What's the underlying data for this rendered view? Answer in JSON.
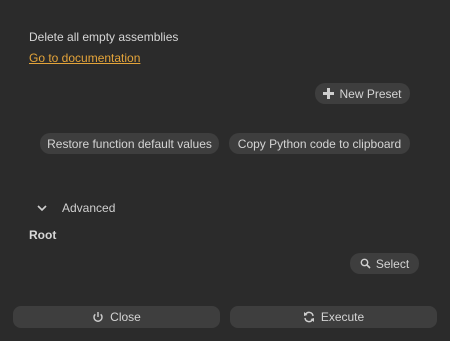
{
  "content": {
    "description": "Delete all empty assemblies",
    "doc_link": "Go to documentation"
  },
  "presets": {
    "new_preset_label": "New Preset"
  },
  "actions": {
    "restore_label": "Restore function default values",
    "copy_label": "Copy Python code to clipboard"
  },
  "advanced": {
    "label": "Advanced",
    "expanded": false
  },
  "root": {
    "label": "Root",
    "select_label": "Select"
  },
  "footer": {
    "close_label": "Close",
    "execute_label": "Execute"
  },
  "colors": {
    "background": "#2b2b2b",
    "button": "#3e3e3e",
    "link": "#e4a43a",
    "text": "#d4d4d4"
  },
  "icons": {
    "new_preset": "plus-icon",
    "advanced": "chevron-down-icon",
    "select": "search-icon",
    "close": "power-icon",
    "execute": "refresh-icon"
  }
}
